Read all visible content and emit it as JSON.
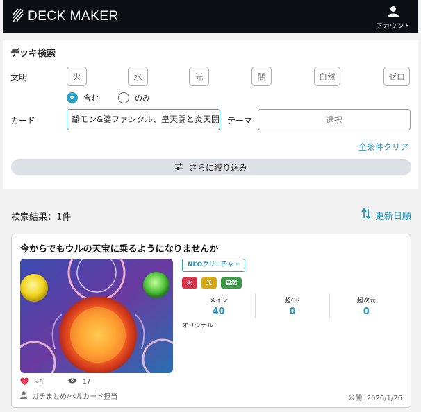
{
  "header": {
    "logo_text": "DECK MAKER",
    "account_label": "アカウント"
  },
  "search": {
    "title": "デッキ検索",
    "civ_label": "文明",
    "civs": [
      "火",
      "水",
      "光",
      "闇",
      "自然",
      "ゼロ"
    ],
    "mode_options": [
      {
        "label": "含む",
        "selected": true
      },
      {
        "label": "のみ",
        "selected": false
      }
    ],
    "card_label": "カード",
    "card_value": "爺モン&婆ファンクル、皇天闘と炎天闘",
    "theme_label": "テーマ",
    "theme_placeholder": "選択",
    "clear_label": "全条件クリア",
    "refine_label": "さらに絞り込み"
  },
  "results": {
    "count_text": "検索結果：1件",
    "sort_label": "更新日順"
  },
  "deck": {
    "title": "今からでもウルの天宝に乗るようになりませんか",
    "type_badge": "NEOクリーチャー",
    "civ_tags": [
      {
        "label": "火",
        "color": "#d9344e"
      },
      {
        "label": "光",
        "color": "#d8a810"
      },
      {
        "label": "自然",
        "color": "#3f9a49"
      }
    ],
    "counts": [
      {
        "label": "メイン",
        "value": "40"
      },
      {
        "label": "超GR",
        "value": "0"
      },
      {
        "label": "超次元",
        "value": "0"
      }
    ],
    "regulation": "オリジナル",
    "likes": "~5",
    "views": "17",
    "author": "ガチまとめ/ベルカード担当",
    "published": "公開: 2026/1/26"
  },
  "colors": {
    "accent": "#2aa3c7",
    "link": "#2a90b8",
    "header_bg": "#0c0f14",
    "heart": "#e0395a"
  },
  "icons": [
    "logo-stripes-icon",
    "account-icon",
    "sliders-icon",
    "sort-arrows-icon",
    "heart-icon",
    "eye-icon",
    "user-icon"
  ]
}
